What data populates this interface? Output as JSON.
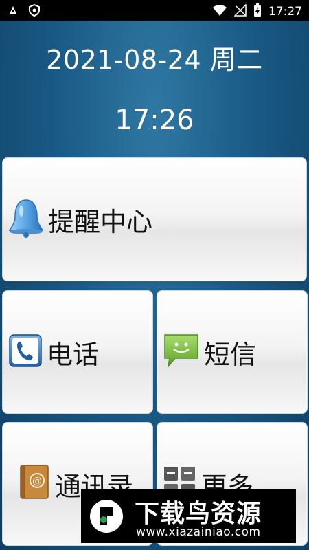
{
  "status_bar": {
    "time": "17:27",
    "left_icons": [
      "android-debug-icon",
      "shield-notification-icon"
    ],
    "right_icons": [
      "wifi-icon",
      "no-signal-icon",
      "battery-charging-icon"
    ]
  },
  "header": {
    "date": "2021-08-24 周二",
    "time": "17:26"
  },
  "tiles": {
    "reminder": {
      "label": "提醒中心",
      "icon": "bell-icon"
    },
    "phone": {
      "label": "电话",
      "icon": "phone-icon"
    },
    "sms": {
      "label": "短信",
      "icon": "message-icon"
    },
    "contacts": {
      "label": "通讯录",
      "icon": "address-book-icon"
    },
    "more": {
      "label": "更多",
      "icon": "apps-grid-icon"
    }
  },
  "watermark": {
    "title": "下载鸟资源",
    "url": "www.xiazainiao.com"
  },
  "colors": {
    "background": "#1a5a86",
    "status_bar": "#000000",
    "tile": "#f4f4f4",
    "message_icon": "#7cc242",
    "bell_icon": "#5aa6e6"
  }
}
